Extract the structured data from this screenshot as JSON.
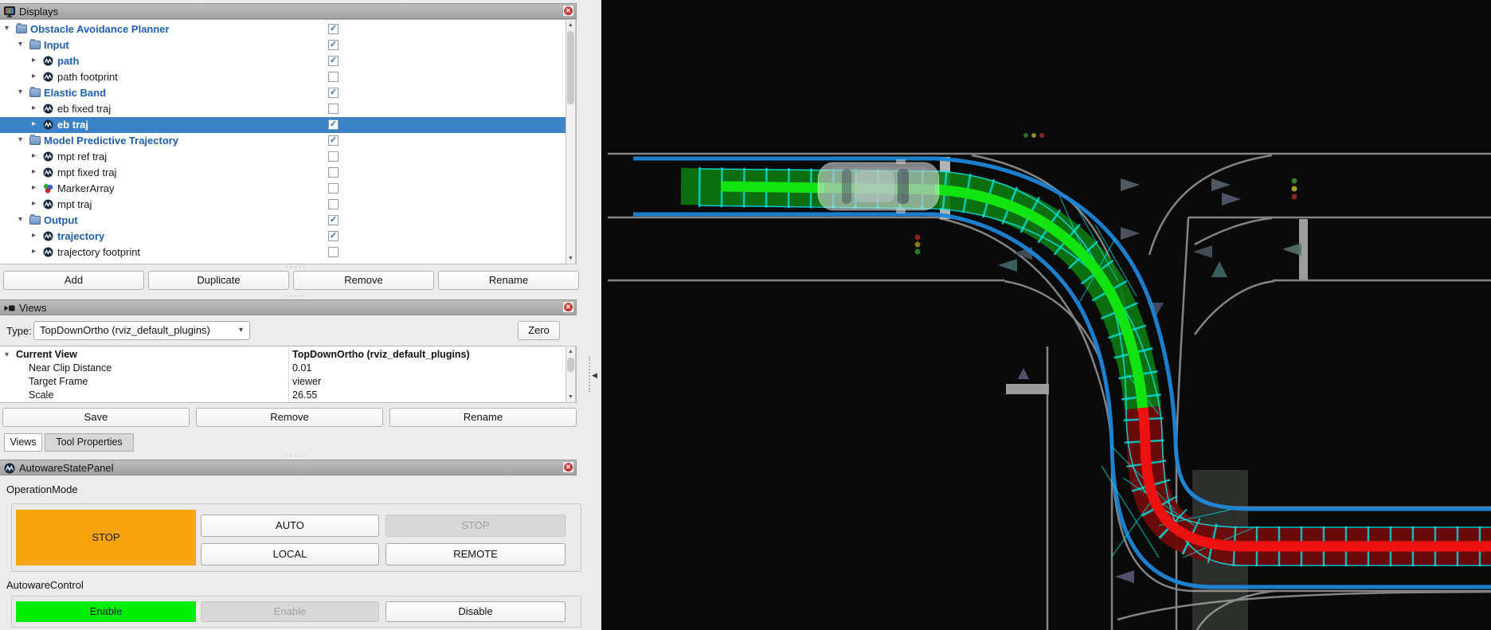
{
  "displays_panel": {
    "title": "Displays",
    "tree": [
      {
        "label": "Obstacle Avoidance Planner",
        "level": 0,
        "type": "folder",
        "checked": true,
        "enabled": true
      },
      {
        "label": "Input",
        "level": 1,
        "type": "folder",
        "checked": true,
        "enabled": true
      },
      {
        "label": "path",
        "level": 2,
        "type": "autoware",
        "checked": true,
        "enabled": true
      },
      {
        "label": "path footprint",
        "level": 2,
        "type": "autoware",
        "checked": false,
        "enabled": false
      },
      {
        "label": "Elastic Band",
        "level": 1,
        "type": "folder",
        "checked": true,
        "enabled": true
      },
      {
        "label": "eb fixed traj",
        "level": 2,
        "type": "autoware",
        "checked": false,
        "enabled": false
      },
      {
        "label": "eb traj",
        "level": 2,
        "type": "autoware",
        "checked": true,
        "enabled": true,
        "selected": true
      },
      {
        "label": "Model Predictive Trajectory",
        "level": 1,
        "type": "folder",
        "checked": true,
        "enabled": true
      },
      {
        "label": "mpt ref traj",
        "level": 2,
        "type": "autoware",
        "checked": false,
        "enabled": false
      },
      {
        "label": "mpt fixed traj",
        "level": 2,
        "type": "autoware",
        "checked": false,
        "enabled": false
      },
      {
        "label": "MarkerArray",
        "level": 2,
        "type": "marker",
        "checked": false,
        "enabled": false
      },
      {
        "label": "mpt traj",
        "level": 2,
        "type": "autoware",
        "checked": false,
        "enabled": false
      },
      {
        "label": "Output",
        "level": 1,
        "type": "folder",
        "checked": true,
        "enabled": true
      },
      {
        "label": "trajectory",
        "level": 2,
        "type": "autoware",
        "checked": true,
        "enabled": true
      },
      {
        "label": "trajectory footprint",
        "level": 2,
        "type": "autoware",
        "checked": false,
        "enabled": false
      }
    ],
    "buttons": [
      "Add",
      "Duplicate",
      "Remove",
      "Rename"
    ]
  },
  "views_panel": {
    "title": "Views",
    "type_label": "Type:",
    "type_value": "TopDownOrtho (rviz_default_plugins)",
    "zero_button": "Zero",
    "properties": [
      {
        "name": "Current View",
        "value": "TopDownOrtho (rviz_default_plugins)",
        "bold": true,
        "expanded": true
      },
      {
        "name": "Near Clip Distance",
        "value": "0.01"
      },
      {
        "name": "Target Frame",
        "value": "viewer"
      },
      {
        "name": "Scale",
        "value": "26.55"
      }
    ],
    "buttons": [
      "Save",
      "Remove",
      "Rename"
    ],
    "tabs": [
      {
        "label": "Views",
        "active": true
      },
      {
        "label": "Tool Properties",
        "active": false
      }
    ]
  },
  "autoware_panel": {
    "title": "AutowareStatePanel",
    "operation_mode": {
      "label": "OperationMode",
      "status": "STOP",
      "buttons": [
        {
          "label": "AUTO",
          "disabled": false
        },
        {
          "label": "STOP",
          "disabled": true
        },
        {
          "label": "LOCAL",
          "disabled": false
        },
        {
          "label": "REMOTE",
          "disabled": false
        }
      ]
    },
    "autoware_control": {
      "label": "AutowareControl",
      "status": "Enable",
      "buttons": [
        {
          "label": "Enable",
          "disabled": true
        },
        {
          "label": "Disable",
          "disabled": false
        }
      ]
    }
  },
  "ui": {
    "check_glyph": "✓",
    "close_glyph": "✕",
    "expand_glyph": "▸",
    "collapse_glyph": "▾",
    "dropdown_glyph": "▾",
    "splitter_glyph": "◀",
    "dots_glyph": "·····",
    "colors": {
      "selection": "#3c82c6",
      "enabled_text": "#1d5fae",
      "status_orange": "#f7a40e",
      "status_green": "#00ee00",
      "check": "#2d6cb5"
    }
  },
  "viewport": {
    "colors": {
      "background": "#0a0a0a",
      "road": "#8f8f8f",
      "path_blue": "#1d86d8",
      "trajectory_green": "#12e412",
      "footprint_green": "#0c7a10",
      "trajectory_red": "#ee1111",
      "footprint_red": "#6f0a0a",
      "bounds_cyan": "#00e5e5"
    }
  }
}
